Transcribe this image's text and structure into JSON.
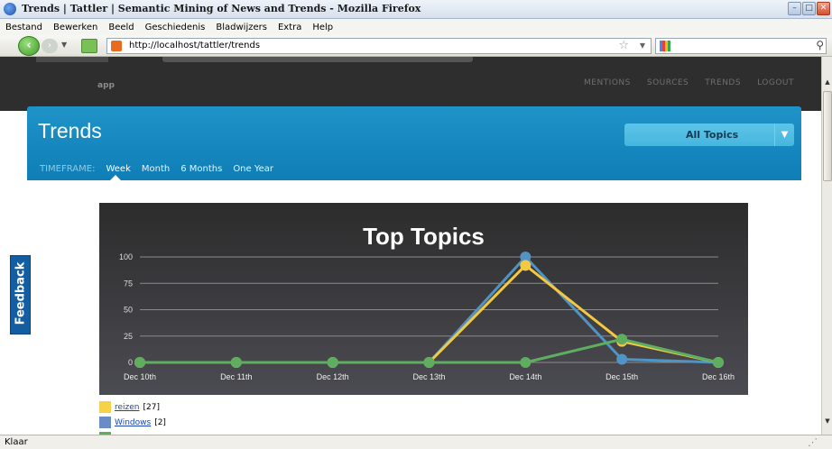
{
  "window": {
    "title": "Trends | Tattler | Semantic Mining of News and Trends - Mozilla Firefox",
    "controls": [
      "–",
      "□",
      "✕"
    ]
  },
  "menu": [
    "Bestand",
    "Bewerken",
    "Beeld",
    "Geschiedenis",
    "Bladwijzers",
    "Extra",
    "Help"
  ],
  "nav": {
    "url": "http://localhost/tattler/trends",
    "back_glyph": "‹",
    "forward_glyph": "›",
    "star_glyph": "☆"
  },
  "site": {
    "logo_sub": "app",
    "topnav": [
      "MENTIONS",
      "SOURCES",
      "TRENDS",
      "LOGOUT"
    ],
    "page_title": "Trends",
    "topic_select": "All Topics",
    "timeframe_label": "TIMEFRAME:",
    "timeframes": [
      "Week",
      "Month",
      "6 Months",
      "One Year"
    ],
    "active_timeframe": "Week",
    "feedback": "Feedback"
  },
  "legend": [
    {
      "name": "reizen",
      "count": "[27]",
      "color": "#f8d14b"
    },
    {
      "name": "Windows",
      "count": "[2]",
      "color": "#6a8cc4"
    },
    {
      "name": "",
      "count": "",
      "color": "#5fae60"
    }
  ],
  "status": "Klaar",
  "chart_data": {
    "type": "line",
    "title": "Top Topics",
    "xlabel": "",
    "ylabel": "",
    "x": [
      "Dec 10th",
      "Dec 11th",
      "Dec 12th",
      "Dec 13th",
      "Dec 14th",
      "Dec 15th",
      "Dec 16th"
    ],
    "ylim": [
      0,
      100
    ],
    "yticks": [
      0,
      25,
      50,
      75,
      100
    ],
    "grid": true,
    "background": "#2c2c2c",
    "series": [
      {
        "color": "#4f94c4",
        "values": [
          0,
          0,
          0,
          0,
          100,
          3,
          0
        ]
      },
      {
        "color": "#f5c842",
        "values": [
          0,
          0,
          0,
          0,
          92,
          20,
          0
        ]
      },
      {
        "color": "#5fae60",
        "values": [
          0,
          0,
          0,
          0,
          0,
          22,
          0
        ]
      }
    ]
  }
}
